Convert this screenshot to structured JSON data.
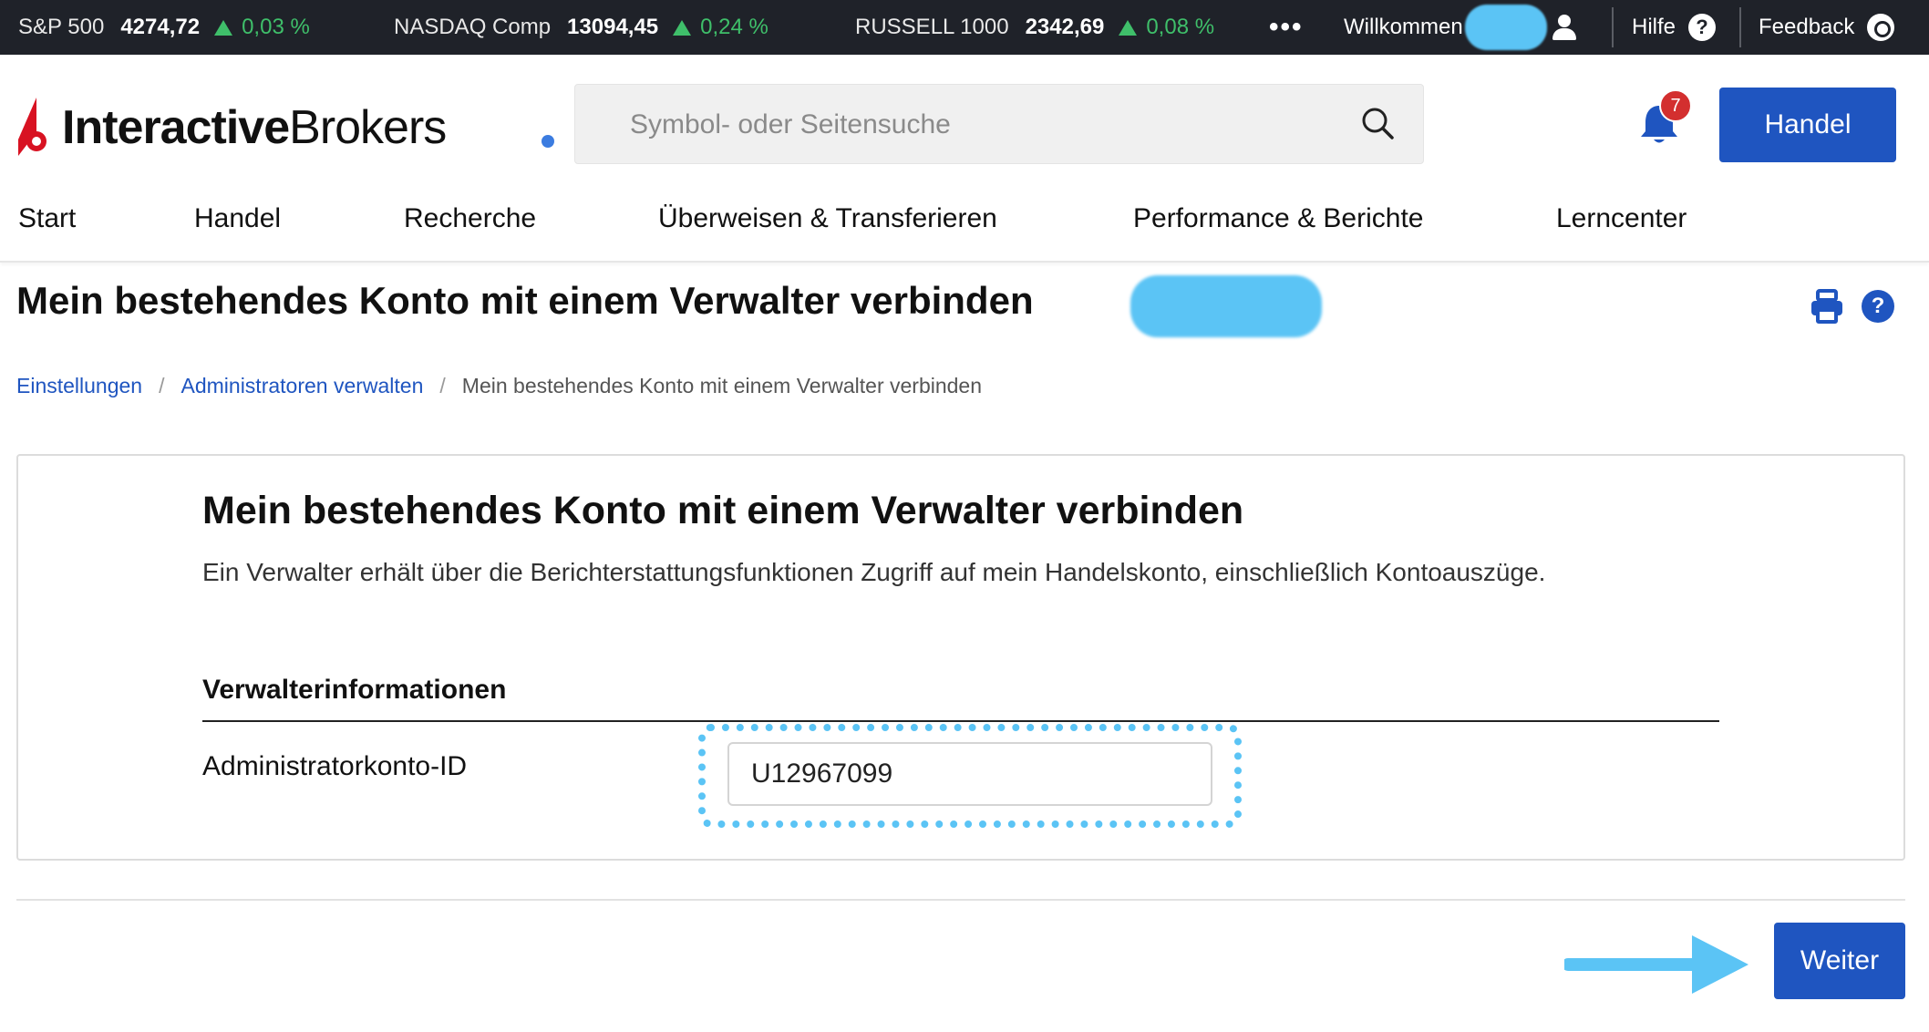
{
  "ticker": {
    "items": [
      {
        "name": "S&P 500",
        "value": "4274,72",
        "change": "0,03 %"
      },
      {
        "name": "NASDAQ Comp",
        "value": "13094,45",
        "change": "0,24 %"
      },
      {
        "name": "RUSSELL 1000",
        "value": "2342,69",
        "change": "0,08 %"
      }
    ],
    "more": "•••",
    "welcome": "Willkommen",
    "help": "Hilfe",
    "feedback": "Feedback",
    "up_color": "#3fbf6a"
  },
  "header": {
    "logo": {
      "part1": "Interactive",
      "part2": "Brokers"
    },
    "search_placeholder": "Symbol- oder Seitensuche",
    "notification_count": "7",
    "trade_button": "Handel",
    "nav": [
      "Start",
      "Handel",
      "Recherche",
      "Überweisen & Transferieren",
      "Performance & Berichte",
      "Lerncenter"
    ]
  },
  "page": {
    "title": "Mein bestehendes Konto mit einem Verwalter verbinden",
    "breadcrumb": [
      "Einstellungen",
      "Administratoren verwalten",
      "Mein bestehendes Konto mit einem Verwalter verbinden"
    ]
  },
  "card": {
    "title": "Mein bestehendes Konto mit einem Verwalter verbinden",
    "description": "Ein Verwalter erhält über die Berichterstattungsfunktionen Zugriff auf mein Handelskonto, einschließlich Kontoauszüge.",
    "section_heading": "Verwalterinformationen",
    "field_label": "Administratorkonto-ID",
    "field_value": "U12967099"
  },
  "footer": {
    "next_button": "Weiter"
  },
  "colors": {
    "brand_blue": "#1f55c0",
    "annotation": "#5bc4f5",
    "badge_red": "#d32f2f",
    "logo_red": "#d81222"
  }
}
